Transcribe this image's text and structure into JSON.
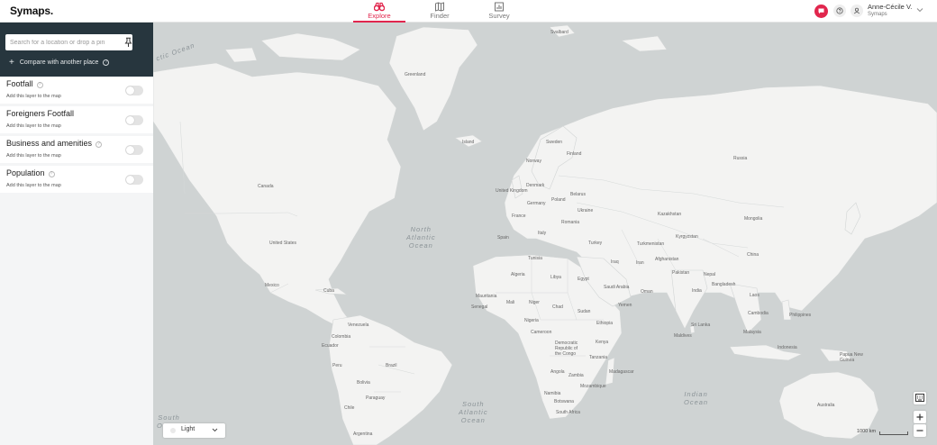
{
  "app": {
    "logo": "Symaps."
  },
  "nav": {
    "tabs": [
      {
        "label": "Explore",
        "icon": "binoculars-icon",
        "active": true
      },
      {
        "label": "Finder",
        "icon": "map-icon",
        "active": false
      },
      {
        "label": "Survey",
        "icon": "chart-icon",
        "active": false
      }
    ]
  },
  "user": {
    "name": "Anne-Cécile V.",
    "org": "Symaps"
  },
  "colors": {
    "accent": "#e1264d",
    "sidebar_header": "#27363e",
    "map_land": "#f3f3f2",
    "map_water": "#cfd3d3"
  },
  "search": {
    "placeholder": "Search for a location or drop a pin",
    "value": ""
  },
  "compare": {
    "label": "Compare with another place"
  },
  "layers": [
    {
      "title": "Footfall",
      "subtitle": "Add this layer to the map",
      "has_help": true,
      "enabled": false
    },
    {
      "title": "Foreigners Footfall",
      "subtitle": "Add this layer to the map",
      "has_help": false,
      "enabled": false
    },
    {
      "title": "Business and amenities",
      "subtitle": "Add this layer to the map",
      "has_help": true,
      "enabled": false
    },
    {
      "title": "Population",
      "subtitle": "Add this layer to the map",
      "has_help": true,
      "enabled": false
    }
  ],
  "map": {
    "basemap": "Light",
    "scale": "1000 km",
    "oceans": {
      "atlantic_north": [
        "North",
        "Atlantic",
        "Ocean"
      ],
      "atlantic_south": [
        "South",
        "Atlantic",
        "Ocean"
      ],
      "indian": [
        "Indian",
        "Ocean"
      ],
      "pacific_south": [
        "South",
        "Ocean"
      ],
      "arctic": "ctic Ocean"
    },
    "labels": {
      "svalbard": "Svalbard",
      "greenland": "Greenland",
      "iceland": "Island",
      "sweden": "Sweden",
      "finland": "Finland",
      "norway": "Norway",
      "russia": "Russia",
      "denmark": "Denmark",
      "uk": "United Kingdom",
      "poland": "Poland",
      "belarus": "Belarus",
      "germany": "Germany",
      "ukraine": "Ukraine",
      "france": "France",
      "romania": "Romania",
      "kazakhstan": "Kazakhstan",
      "mongolia": "Mongolia",
      "spain": "Spain",
      "italy": "Italy",
      "turkey": "Turkey",
      "turkmenistan": "Turkmenistan",
      "kyrgyzstan": "Kyrgyzstan",
      "china": "China",
      "tunisia": "Tunisia",
      "iraq": "Iraq",
      "iran": "Iran",
      "afghanistan": "Afghanistan",
      "algeria": "Algeria",
      "libya": "Libya",
      "egypt": "Egypt",
      "saudi": "Saudi Arabia",
      "oman": "Oman",
      "pakistan": "Pakistan",
      "nepal": "Nepal",
      "india": "India",
      "bangladesh": "Bangladesh",
      "laos": "Laos",
      "mauritania": "Mauritania",
      "mali": "Mali",
      "niger": "Niger",
      "chad": "Chad",
      "sudan": "Sudan",
      "yemen": "Yemen",
      "senegal": "Senegal",
      "nigeria": "Nigeria",
      "ethiopia": "Ethiopia",
      "cambodia": "Cambodia",
      "philippines": "Philippines",
      "srilanka": "Sri Lanka",
      "maldives": "Maldives",
      "malaysia": "Malaysia",
      "cameroon": "Cameroon",
      "drc": [
        "Democratic",
        "Republic of",
        "the Congo"
      ],
      "kenya": "Kenya",
      "tanzania": "Tanzania",
      "angola": "Angola",
      "zambia": "Zambia",
      "namibia": "Namibia",
      "mozambique": "Mozambique",
      "madagascar": "Madagascar",
      "botswana": "Botswana",
      "southafrica": "South Africa",
      "indonesia": "Indonesia",
      "png": [
        "Papua New",
        "Guinea"
      ],
      "australia": "Australia",
      "canada": "Canada",
      "usa": "United States",
      "mexico": "Mexico",
      "cuba": "Cuba",
      "venezuela": "Venezuela",
      "colombia": "Colombia",
      "ecuador": "Ecuador",
      "peru": "Peru",
      "brazil": "Brazil",
      "bolivia": "Bolivia",
      "paraguay": "Paraguay",
      "chile": "Chile",
      "argentina": "Argentina"
    }
  }
}
